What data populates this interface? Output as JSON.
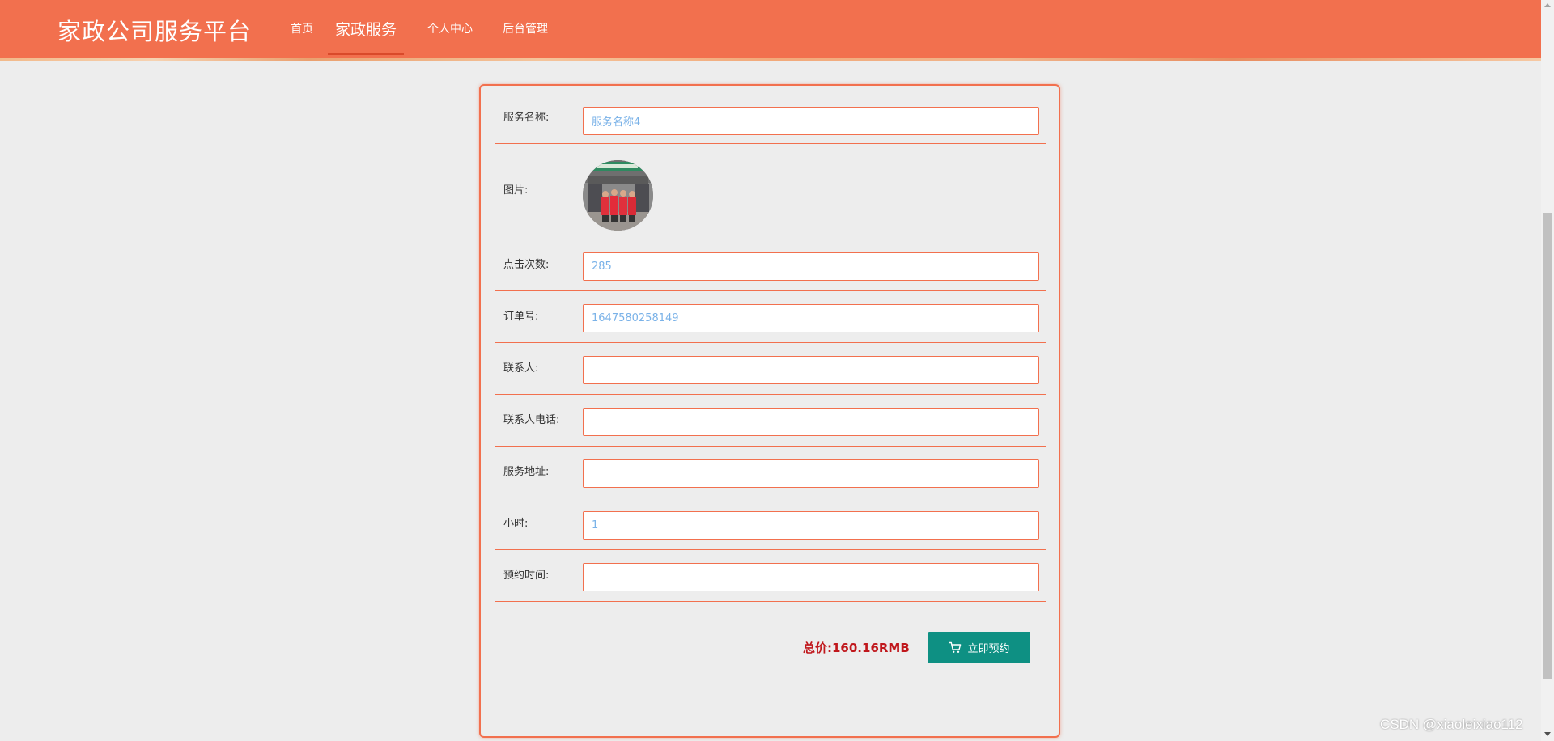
{
  "header": {
    "brand": "家政公司服务平台",
    "nav": [
      {
        "label": "首页"
      },
      {
        "label": "家政服务"
      },
      {
        "label": "个人中心"
      },
      {
        "label": "后台管理"
      }
    ],
    "active_nav_index": 1,
    "bg_color": "#f2704e"
  },
  "form": {
    "fields": [
      {
        "label": "服务名称:",
        "value": "服务名称4"
      },
      {
        "label": "图片:"
      },
      {
        "label": "点击次数:",
        "value": "285"
      },
      {
        "label": "订单号:",
        "value": "1647580258149"
      },
      {
        "label": "联系人:",
        "value": ""
      },
      {
        "label": "联系人电话:",
        "value": ""
      },
      {
        "label": "服务地址:",
        "value": ""
      },
      {
        "label": "小时:",
        "value": "1"
      },
      {
        "label": "预约时间:",
        "value": ""
      }
    ],
    "total_label": "总价:",
    "total_value": "160.16RMB",
    "book_button": "立即预约",
    "book_button_icon": "cart-icon",
    "button_color": "#0e9083"
  },
  "watermark": "CSDN @xiaoleixiao112"
}
